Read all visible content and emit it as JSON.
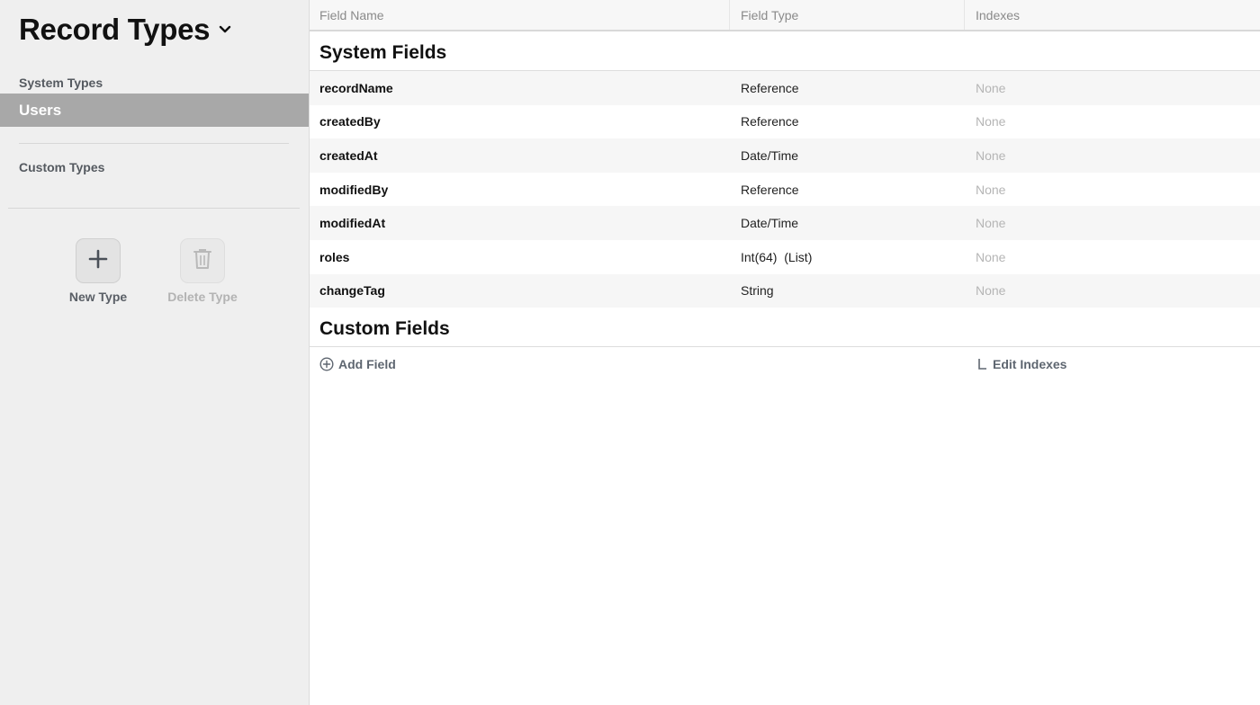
{
  "sidebar": {
    "title": "Record Types",
    "system_types_label": "System Types",
    "selected_item": "Users",
    "custom_types_label": "Custom Types",
    "new_type_label": "New Type",
    "delete_type_label": "Delete Type"
  },
  "table": {
    "headers": [
      "Field Name",
      "Field Type",
      "Indexes"
    ],
    "system_fields_title": "System Fields",
    "system_fields": [
      {
        "name": "recordName",
        "type": "Reference",
        "indexes": "None"
      },
      {
        "name": "createdBy",
        "type": "Reference",
        "indexes": "None"
      },
      {
        "name": "createdAt",
        "type": "Date/Time",
        "indexes": "None"
      },
      {
        "name": "modifiedBy",
        "type": "Reference",
        "indexes": "None"
      },
      {
        "name": "modifiedAt",
        "type": "Date/Time",
        "indexes": "None"
      },
      {
        "name": "roles",
        "type": "Int(64)  (List)",
        "indexes": "None"
      },
      {
        "name": "changeTag",
        "type": "String",
        "indexes": "None"
      }
    ],
    "custom_fields_title": "Custom Fields",
    "add_field_label": "Add Field",
    "edit_indexes_label": "Edit Indexes"
  },
  "colors": {
    "sidebar_bg": "#efefef",
    "selected_bg": "#a8a8a8",
    "link_color": "#5e6670"
  },
  "icons": {
    "title_chevron": "chevron-down-icon",
    "new_type": "plus-icon",
    "delete_type": "trash-icon",
    "add_field": "plus-circle-icon",
    "edit_indexes": "corner-icon"
  }
}
